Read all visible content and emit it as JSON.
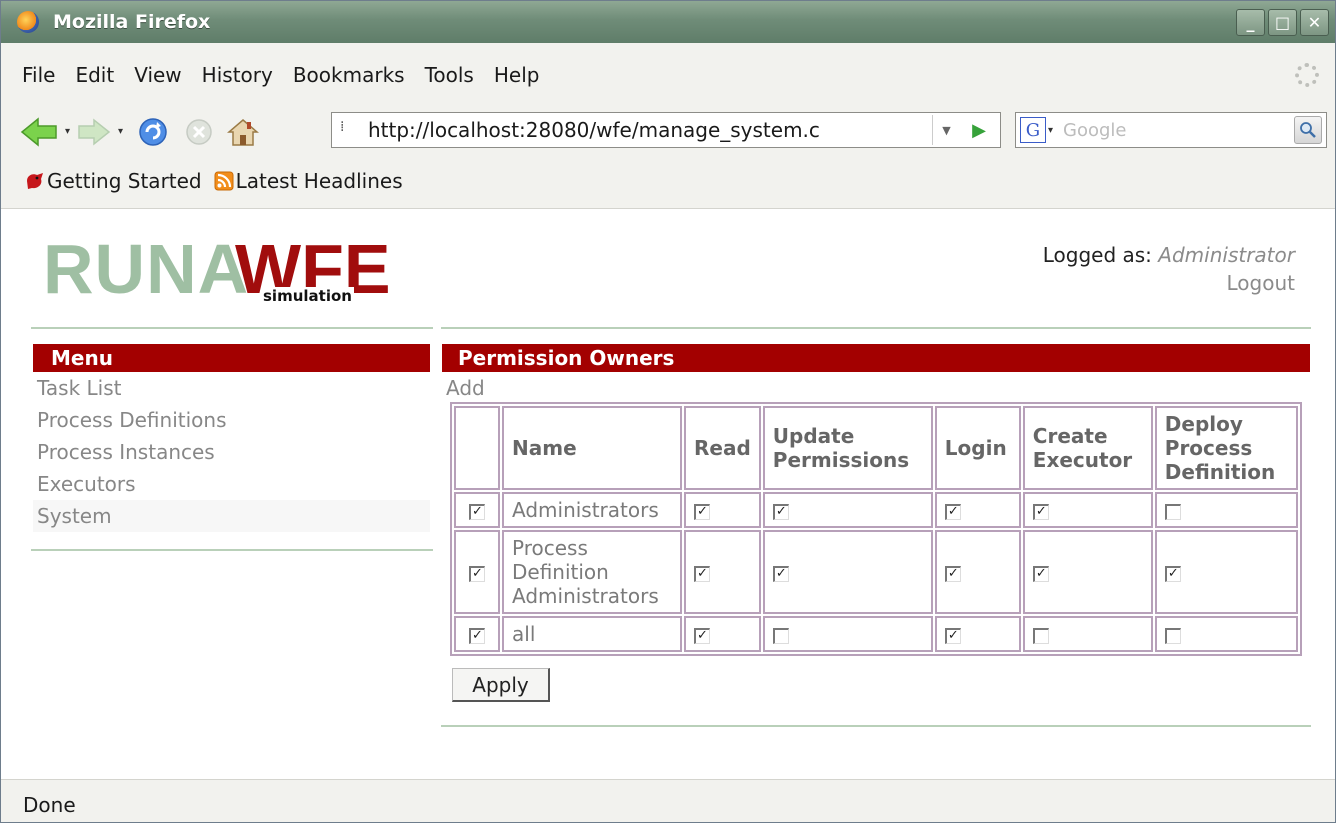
{
  "window": {
    "title": "Mozilla Firefox",
    "buttons": [
      "_",
      "□",
      "✕"
    ]
  },
  "menubar": {
    "items": [
      "File",
      "Edit",
      "View",
      "History",
      "Bookmarks",
      "Tools",
      "Help"
    ]
  },
  "navbar": {
    "url": "http://localhost:28080/wfe/manage_system.c",
    "search_placeholder": "Google"
  },
  "bookmarks": {
    "items": [
      "Getting Started",
      "Latest Headlines"
    ]
  },
  "header": {
    "logo_runa": "RUNA",
    "logo_wfe": "WFE",
    "logo_sub": "simulation",
    "logged_label": "Logged as:",
    "user": "Administrator",
    "logout": "Logout"
  },
  "menu": {
    "title": "Menu",
    "items": [
      "Task List",
      "Process Definitions",
      "Process Instances",
      "Executors",
      "System"
    ]
  },
  "permissions": {
    "title": "Permission Owners",
    "add_label": "Add",
    "columns": [
      "",
      "Name",
      "Read",
      "Update Permissions",
      "Login",
      "Create Executor",
      "Deploy Process Definition"
    ],
    "rows": [
      {
        "selected": true,
        "name": "Administrators",
        "perms": [
          true,
          true,
          true,
          true,
          false
        ]
      },
      {
        "selected": true,
        "name": "Process Definition Administrators",
        "perms": [
          true,
          true,
          true,
          true,
          true
        ]
      },
      {
        "selected": true,
        "name": "all",
        "perms": [
          true,
          false,
          true,
          false,
          false
        ]
      }
    ],
    "apply_label": "Apply"
  },
  "status": {
    "text": "Done"
  }
}
